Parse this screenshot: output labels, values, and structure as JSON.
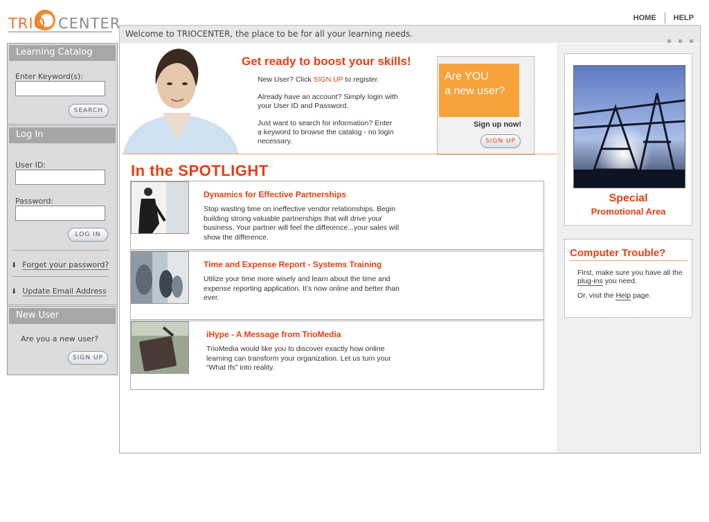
{
  "logo": {
    "left": "TRIO",
    "right": "CENTER"
  },
  "topnav": {
    "home": "HOME",
    "help": "HELP"
  },
  "welcome": "Welcome to TRIOCENTER, the place to be for all your learning needs.",
  "catalog": {
    "title": "Learning Catalog",
    "keyword_label": "Enter Keyword(s):",
    "search_button": "SEARCH"
  },
  "login": {
    "title": "Log In",
    "userid_label": "User ID:",
    "password_label": "Password:",
    "login_button": "LOG IN",
    "forgot": "Forget your password?",
    "update_email": "Update Email Address"
  },
  "newuser": {
    "title": "New User",
    "question": "Are you a new user?",
    "signup_button": "SIGN UP"
  },
  "hero": {
    "title": "Get ready to boost your skills!",
    "p1_pre": "New User? Click ",
    "p1_link": "SIGN UP",
    "p1_post": " to register.",
    "p2": "Already have an account? Simply login with your User ID and Password.",
    "p3": "Just want to search for information? Enter a keyword to browse the catalog - no login necessary.",
    "box_line1": "Are YOU",
    "box_line2": "a new user?",
    "signup_now": "Sign up now!",
    "signup_button": "SIGN UP"
  },
  "spotlight": {
    "title": "In the SPOTLIGHT",
    "items": [
      {
        "title": "Dynamics for Effective Partnerships",
        "body": "Stop wasting time on ineffective vendor relationships. Begin building strong valuable partnerships that will drive your business. Your partner will feel the difference...your sales will show the difference."
      },
      {
        "title": "Time and Expense Report - Systems Training",
        "body": "Utilize your time more wisely and learn about the time and expense reporting application. It’s now online and better than ever."
      },
      {
        "title": "iHype - A Message from TrioMedia",
        "body": "TrioMedia would like you to discover exactly how online learning can transform your organization. Let us turn your “What Ifs” into reality."
      }
    ]
  },
  "promo": {
    "line1": "Special",
    "line2": "Promotional Area"
  },
  "trouble": {
    "title": "Computer Trouble?",
    "p1_pre": "First, make sure you have all the ",
    "p1_link": "plug-ins",
    "p1_post": " you need.",
    "p2_pre": "Or, visit the ",
    "p2_link": "Help",
    "p2_post": " page."
  },
  "colors": {
    "accent": "#e63e14",
    "orange_box": "#f7a23b",
    "panel_bg": "#dcdcdc",
    "panel_head": "#a7a7a7"
  }
}
